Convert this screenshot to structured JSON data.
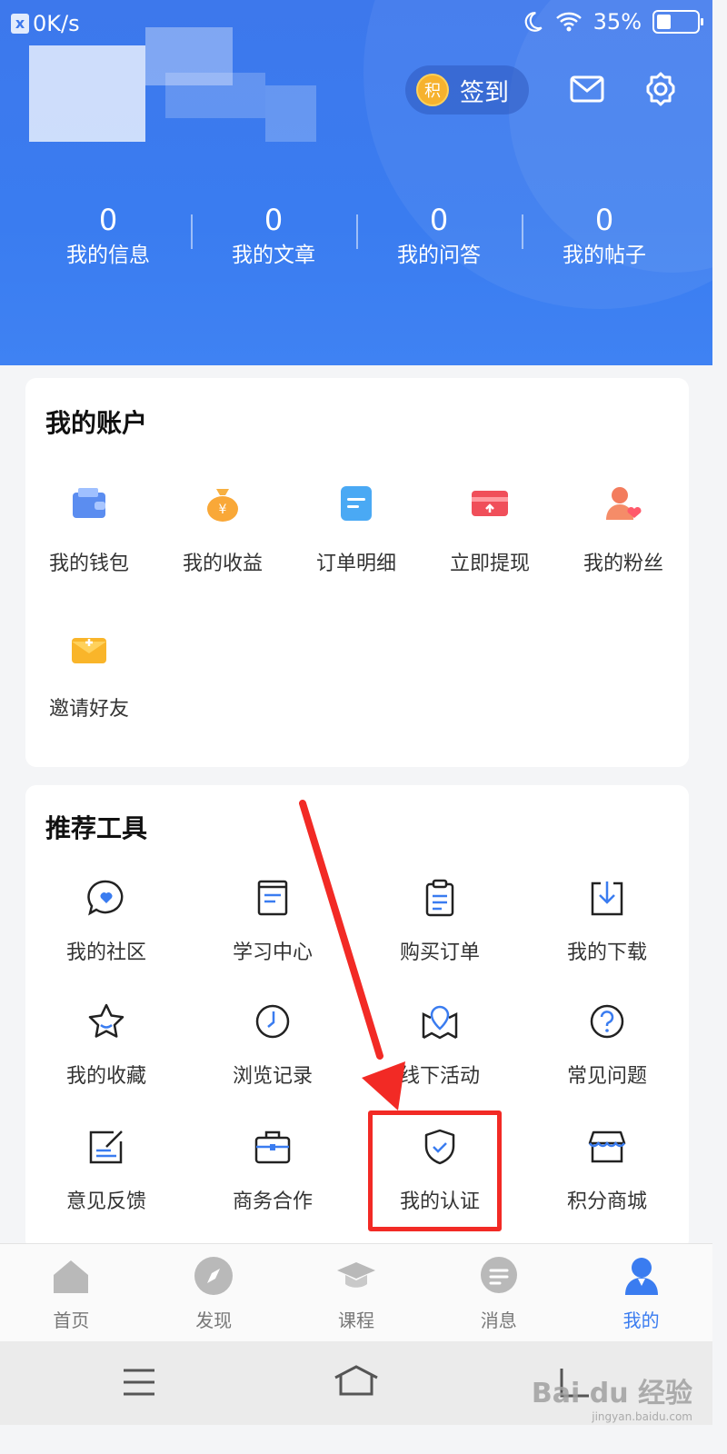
{
  "status_bar": {
    "net_speed": "0K/s",
    "battery": "35%",
    "battery_level": 0.35
  },
  "header": {
    "signin_coin": "积",
    "signin_label": "签到",
    "stats": [
      {
        "value": "0",
        "label": "我的信息"
      },
      {
        "value": "0",
        "label": "我的文章"
      },
      {
        "value": "0",
        "label": "我的问答"
      },
      {
        "value": "0",
        "label": "我的帖子"
      }
    ]
  },
  "account": {
    "title": "我的账户",
    "items": [
      {
        "label": "我的钱包",
        "icon": "wallet-icon"
      },
      {
        "label": "我的收益",
        "icon": "money-bag-icon"
      },
      {
        "label": "订单明细",
        "icon": "order-list-icon"
      },
      {
        "label": "立即提现",
        "icon": "withdraw-card-icon"
      },
      {
        "label": "我的粉丝",
        "icon": "fans-icon"
      },
      {
        "label": "邀请好友",
        "icon": "invite-envelope-icon"
      }
    ]
  },
  "tools": {
    "title": "推荐工具",
    "items": [
      {
        "label": "我的社区",
        "icon": "community-icon"
      },
      {
        "label": "学习中心",
        "icon": "study-icon"
      },
      {
        "label": "购买订单",
        "icon": "clipboard-icon"
      },
      {
        "label": "我的下载",
        "icon": "download-icon"
      },
      {
        "label": "我的收藏",
        "icon": "star-icon"
      },
      {
        "label": "浏览记录",
        "icon": "clock-icon"
      },
      {
        "label": "线下活动",
        "icon": "map-pin-icon"
      },
      {
        "label": "常见问题",
        "icon": "question-icon"
      },
      {
        "label": "意见反馈",
        "icon": "feedback-icon"
      },
      {
        "label": "商务合作",
        "icon": "briefcase-icon"
      },
      {
        "label": "我的认证",
        "icon": "shield-check-icon"
      },
      {
        "label": "积分商城",
        "icon": "store-icon"
      }
    ]
  },
  "tabbar": {
    "tabs": [
      {
        "label": "首页",
        "icon": "home-icon"
      },
      {
        "label": "发现",
        "icon": "compass-icon"
      },
      {
        "label": "课程",
        "icon": "graduation-cap-icon"
      },
      {
        "label": "消息",
        "icon": "message-icon"
      },
      {
        "label": "我的",
        "icon": "profile-icon",
        "active": true
      }
    ]
  },
  "watermark": {
    "text": "Bai du 经验",
    "sub": "jingyan.baidu.com"
  },
  "colors": {
    "primary": "#3a7cf0",
    "highlight": "#f22a25"
  }
}
